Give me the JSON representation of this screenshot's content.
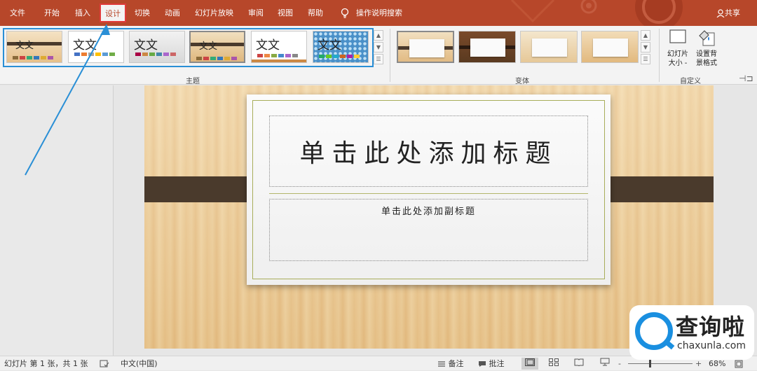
{
  "menubar": {
    "tabs": [
      {
        "label": "文件"
      },
      {
        "label": "开始"
      },
      {
        "label": "插入"
      },
      {
        "label": "设计"
      },
      {
        "label": "切换"
      },
      {
        "label": "动画"
      },
      {
        "label": "幻灯片放映"
      },
      {
        "label": "审阅"
      },
      {
        "label": "视图"
      },
      {
        "label": "帮助"
      }
    ],
    "tell_me": "操作说明搜索",
    "share": "共享"
  },
  "ribbon": {
    "themes_label": "主题",
    "theme_sample": "文文",
    "variants_label": "变体",
    "custom_label": "自定义",
    "slide_size_l1": "幻灯片",
    "slide_size_l2": "大小 -",
    "bg_format_l1": "设置背",
    "bg_format_l2": "景格式"
  },
  "slide": {
    "title_placeholder": "单击此处添加标题",
    "subtitle_placeholder": "单击此处添加副标题"
  },
  "statusbar": {
    "slide_info": "幻灯片 第 1 张，共 1 张",
    "language": "中文(中国)",
    "notes": "备注",
    "comments": "批注",
    "zoom_minus": "-",
    "zoom_plus": "+",
    "zoom_level": "68%"
  },
  "watermark": {
    "zh": "查询啦",
    "en": "chaxunla.com"
  },
  "colors": {
    "accent": "#b7472a",
    "highlight_box": "#2a8fd6",
    "active_tab_border": "#e03a3a"
  }
}
